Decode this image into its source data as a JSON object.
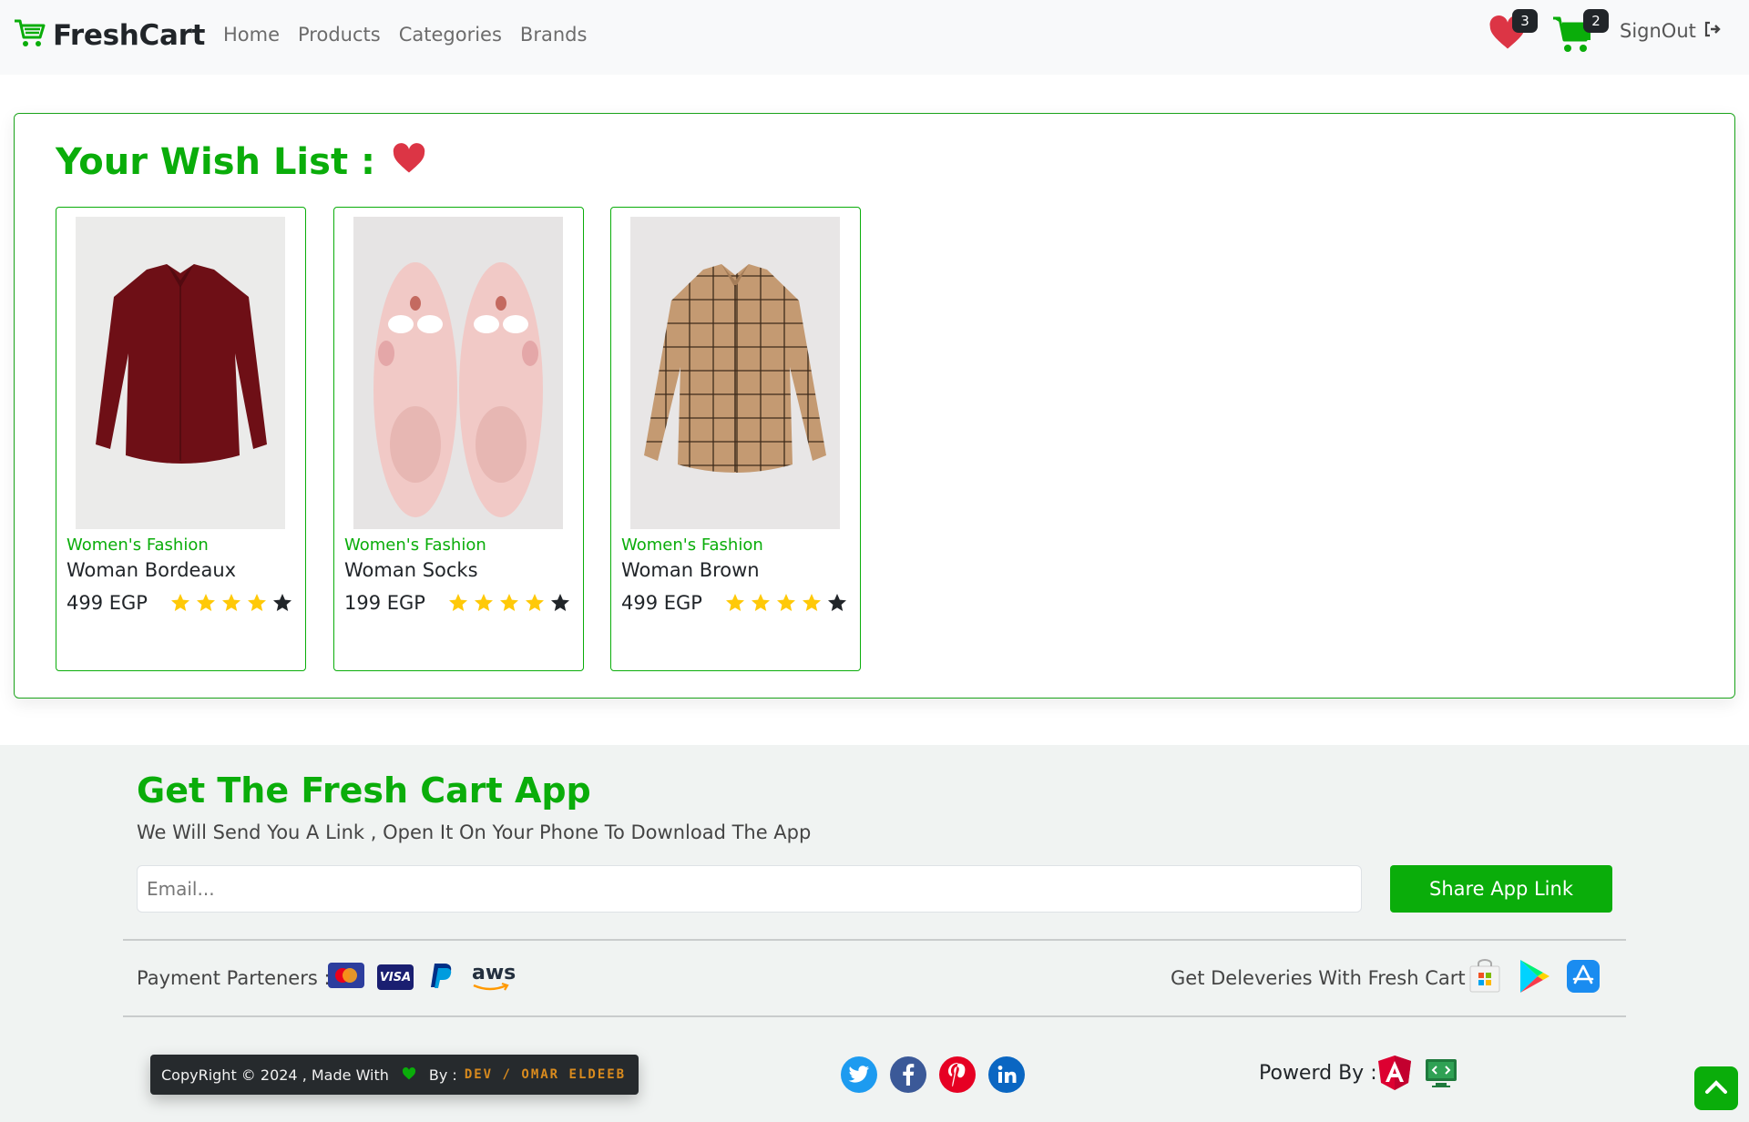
{
  "navbar": {
    "brand": "FreshCart",
    "links": [
      "Home",
      "Products",
      "Categories",
      "Brands"
    ],
    "wishlist_count": "3",
    "cart_count": "2",
    "signout": "SignOut"
  },
  "wishlist": {
    "title": "Your Wish List :",
    "items": [
      {
        "category": "Women's Fashion",
        "title": "Woman Bordeaux",
        "price": "499 EGP",
        "rating": 4,
        "max_rating": 5
      },
      {
        "category": "Women's Fashion",
        "title": "Woman Socks",
        "price": "199 EGP",
        "rating": 4,
        "max_rating": 5
      },
      {
        "category": "Women's Fashion",
        "title": "Woman Brown",
        "price": "499 EGP",
        "rating": 4,
        "max_rating": 5
      }
    ]
  },
  "footer": {
    "app_title": "Get The Fresh Cart App",
    "app_subtitle": "We Will Send You A Link , Open It On Your Phone To Download The App",
    "email_placeholder": "Email...",
    "share_button": "Share App Link",
    "payment_label": "Payment Parteners :",
    "visa_text": "VISA",
    "aws_text": "aws",
    "deliveries_label": "Get Deleveries With Fresh Cart :",
    "copyright_prefix": "CopyRight © 2024 , Made With",
    "copyright_by": "By :",
    "developer": "DEV / OMAR ELDEEB",
    "powered_label": "Powerd By :"
  },
  "colors": {
    "brand_green": "#0aad0a",
    "heart_red": "#dc3545",
    "star_yellow": "#ffc908"
  }
}
